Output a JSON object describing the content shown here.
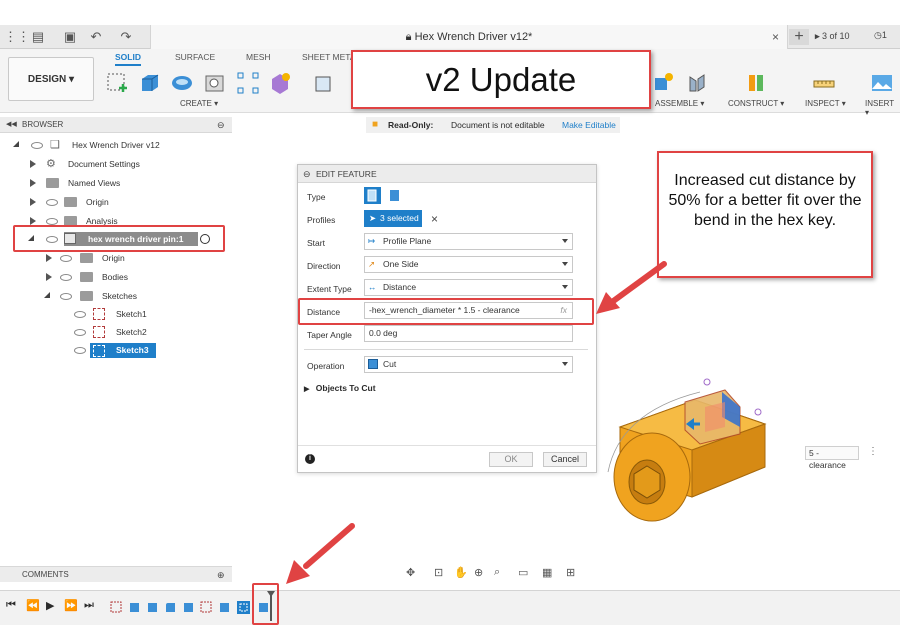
{
  "window": {
    "doc_title": "Hex Wrench Driver v12*",
    "tab_counter": "3 of 10",
    "notif_count": "1"
  },
  "toolbar": {
    "design_label": "DESIGN ▾",
    "tabs": [
      "SOLID",
      "SURFACE",
      "MESH",
      "SHEET META"
    ],
    "groups": {
      "create": "CREATE ▾",
      "assemble": "ASSEMBLE ▾",
      "construct": "CONSTRUCT ▾",
      "inspect": "INSPECT ▾",
      "insert": "INSERT ▾"
    }
  },
  "readonly_bar": {
    "label": "Read-Only:",
    "message": "Document is not editable",
    "action": "Make Editable"
  },
  "browser": {
    "header": "BROWSER",
    "items": [
      {
        "label": "Hex Wrench Driver v12"
      },
      {
        "label": "Document Settings"
      },
      {
        "label": "Named Views"
      },
      {
        "label": "Origin"
      },
      {
        "label": "Analysis"
      },
      {
        "label": "hex wrench driver pin:1"
      },
      {
        "label": "Origin"
      },
      {
        "label": "Bodies"
      },
      {
        "label": "Sketches"
      },
      {
        "label": "Sketch1"
      },
      {
        "label": "Sketch2"
      },
      {
        "label": "Sketch3"
      }
    ]
  },
  "edit_feature": {
    "title": "EDIT FEATURE",
    "rows": {
      "type_label": "Type",
      "profiles_label": "Profiles",
      "profiles_value": "3 selected",
      "start_label": "Start",
      "start_value": "Profile Plane",
      "direction_label": "Direction",
      "direction_value": "One Side",
      "extent_label": "Extent Type",
      "extent_value": "Distance",
      "distance_label": "Distance",
      "distance_value": "-hex_wrench_diameter * 1.5 - clearance",
      "fx": "fx",
      "taper_label": "Taper Angle",
      "taper_value": "0.0 deg",
      "operation_label": "Operation",
      "operation_value": "Cut",
      "objects_label": "Objects To Cut"
    },
    "ok_label": "OK",
    "cancel_label": "Cancel"
  },
  "callouts": {
    "v2_title": "v2 Update",
    "note": "Increased cut distance by 50% for a better fit over the bend in the hex key."
  },
  "canvas_chip": "5 - clearance",
  "comments": {
    "header": "COMMENTS"
  },
  "colors": {
    "accent": "#1f7fc9",
    "callout_red": "#e04343",
    "model_orange": "#f0a31f"
  }
}
